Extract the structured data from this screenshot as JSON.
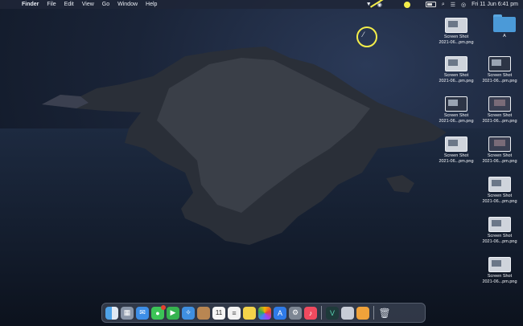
{
  "menubar": {
    "apple_symbol": "",
    "items": [
      "Finder",
      "File",
      "Edit",
      "View",
      "Go",
      "Window",
      "Help"
    ],
    "datetime": "Fri 11 Jun  6:41 pm"
  },
  "desktop_icons": [
    {
      "label_line1": "Screen Shot",
      "label_line2": "2021-06...pm.png",
      "kind": "screenshot"
    },
    {
      "label_line1": "A",
      "label_line2": "",
      "kind": "folder"
    },
    {
      "label_line1": "Screen Shot",
      "label_line2": "2021-06...pm.png",
      "kind": "screenshot"
    },
    {
      "label_line1": "Screen Shot",
      "label_line2": "2021-06...pm.png",
      "kind": "screenshot"
    },
    {
      "label_line1": "Screen Shot",
      "label_line2": "2021-06...pm.png",
      "kind": "screenshot"
    },
    {
      "label_line1": "Screen Shot",
      "label_line2": "2021-06...pm.png",
      "kind": "screenshot"
    },
    {
      "label_line1": "Screen Shot",
      "label_line2": "2021-06...pm.png",
      "kind": "screenshot"
    },
    {
      "label_line1": "Screen Shot",
      "label_line2": "2021-06...pm.png",
      "kind": "screenshot"
    },
    {
      "label_line1": "Screen Shot",
      "label_line2": "2021-06...pm.png",
      "kind": "screenshot"
    },
    {
      "label_line1": "Screen Shot",
      "label_line2": "2021-06...pm.png",
      "kind": "screenshot"
    },
    {
      "label_line1": "Screen Shot",
      "label_line2": "2021-06...pm.png",
      "kind": "screenshot"
    },
    {
      "label_line1": "Screen Shot",
      "label_line2": "2021-06...pm.png",
      "kind": "screenshot"
    },
    {
      "label_line1": "Screen Shot",
      "label_line2": "2021-06...pm.png",
      "kind": "screenshot"
    }
  ],
  "dock": {
    "calendar_day": "11",
    "apps": [
      "finder-icon",
      "launchpad-icon",
      "mail-icon",
      "messages-icon",
      "facetime-icon",
      "safari-icon",
      "contacts-icon",
      "calendar-icon",
      "reminders-icon",
      "notes-icon",
      "photos-icon",
      "app-store-icon",
      "system-preferences-icon",
      "music-icon",
      "vectorize-icon",
      "preview-icon",
      "pages-icon",
      "trash-icon"
    ]
  },
  "colors": {
    "highlight": "#f4ee4a",
    "folder": "#4b9ad8"
  }
}
